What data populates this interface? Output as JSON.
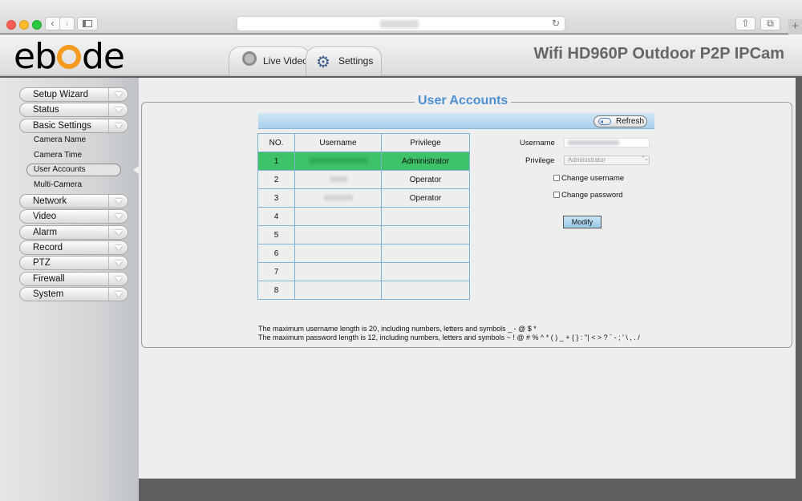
{
  "app": {
    "logo_text": "ebode",
    "product_title": "Wifi HD960P Outdoor P2P IPCam",
    "tabs": [
      {
        "label": "Live Video",
        "icon": "webcam-icon"
      },
      {
        "label": "Settings",
        "icon": "gears-icon"
      }
    ]
  },
  "browser": {
    "back_glyph": "‹",
    "forward_glyph": "›",
    "reload_glyph": "↻",
    "share_glyph": "⇧",
    "tabs_glyph": "⧉",
    "new_tab_glyph": "+"
  },
  "sidebar": {
    "menu": [
      {
        "label": "Setup Wizard"
      },
      {
        "label": "Status"
      },
      {
        "label": "Basic Settings"
      },
      {
        "label": "Network"
      },
      {
        "label": "Video"
      },
      {
        "label": "Alarm"
      },
      {
        "label": "Record"
      },
      {
        "label": "PTZ"
      },
      {
        "label": "Firewall"
      },
      {
        "label": "System"
      }
    ],
    "submenu": [
      {
        "label": "Camera Name"
      },
      {
        "label": "Camera Time"
      },
      {
        "label": "User Accounts"
      },
      {
        "label": "Multi-Camera"
      }
    ]
  },
  "page": {
    "title": "User Accounts",
    "refresh_label": "Refresh",
    "table": {
      "headers": [
        "NO.",
        "Username",
        "Privilege"
      ],
      "rows": [
        {
          "no": "1",
          "privilege": "Administrator"
        },
        {
          "no": "2",
          "privilege": "Operator"
        },
        {
          "no": "3",
          "privilege": "Operator"
        },
        {
          "no": "4",
          "privilege": ""
        },
        {
          "no": "5",
          "privilege": ""
        },
        {
          "no": "6",
          "privilege": ""
        },
        {
          "no": "7",
          "privilege": ""
        },
        {
          "no": "8",
          "privilege": ""
        }
      ]
    },
    "form": {
      "username_label": "Username",
      "privilege_label": "Privilege",
      "privilege_value": "Administrator",
      "change_username_label": "Change username",
      "change_password_label": "Change password",
      "modify_label": "Modify"
    },
    "notes": {
      "username": "The maximum username length is 20, including numbers, letters and symbols _ - @ $ *",
      "password": "The maximum password length is 12, including numbers, letters and symbols ~ ! @ # % ^ * ( ) _ + { } : \"| < > ? ` - ; ' \\ , . /"
    }
  },
  "colors": {
    "accent_title": "#4d8fd1",
    "selected_row": "#3ec268",
    "logo_o": "#f39a1f"
  }
}
